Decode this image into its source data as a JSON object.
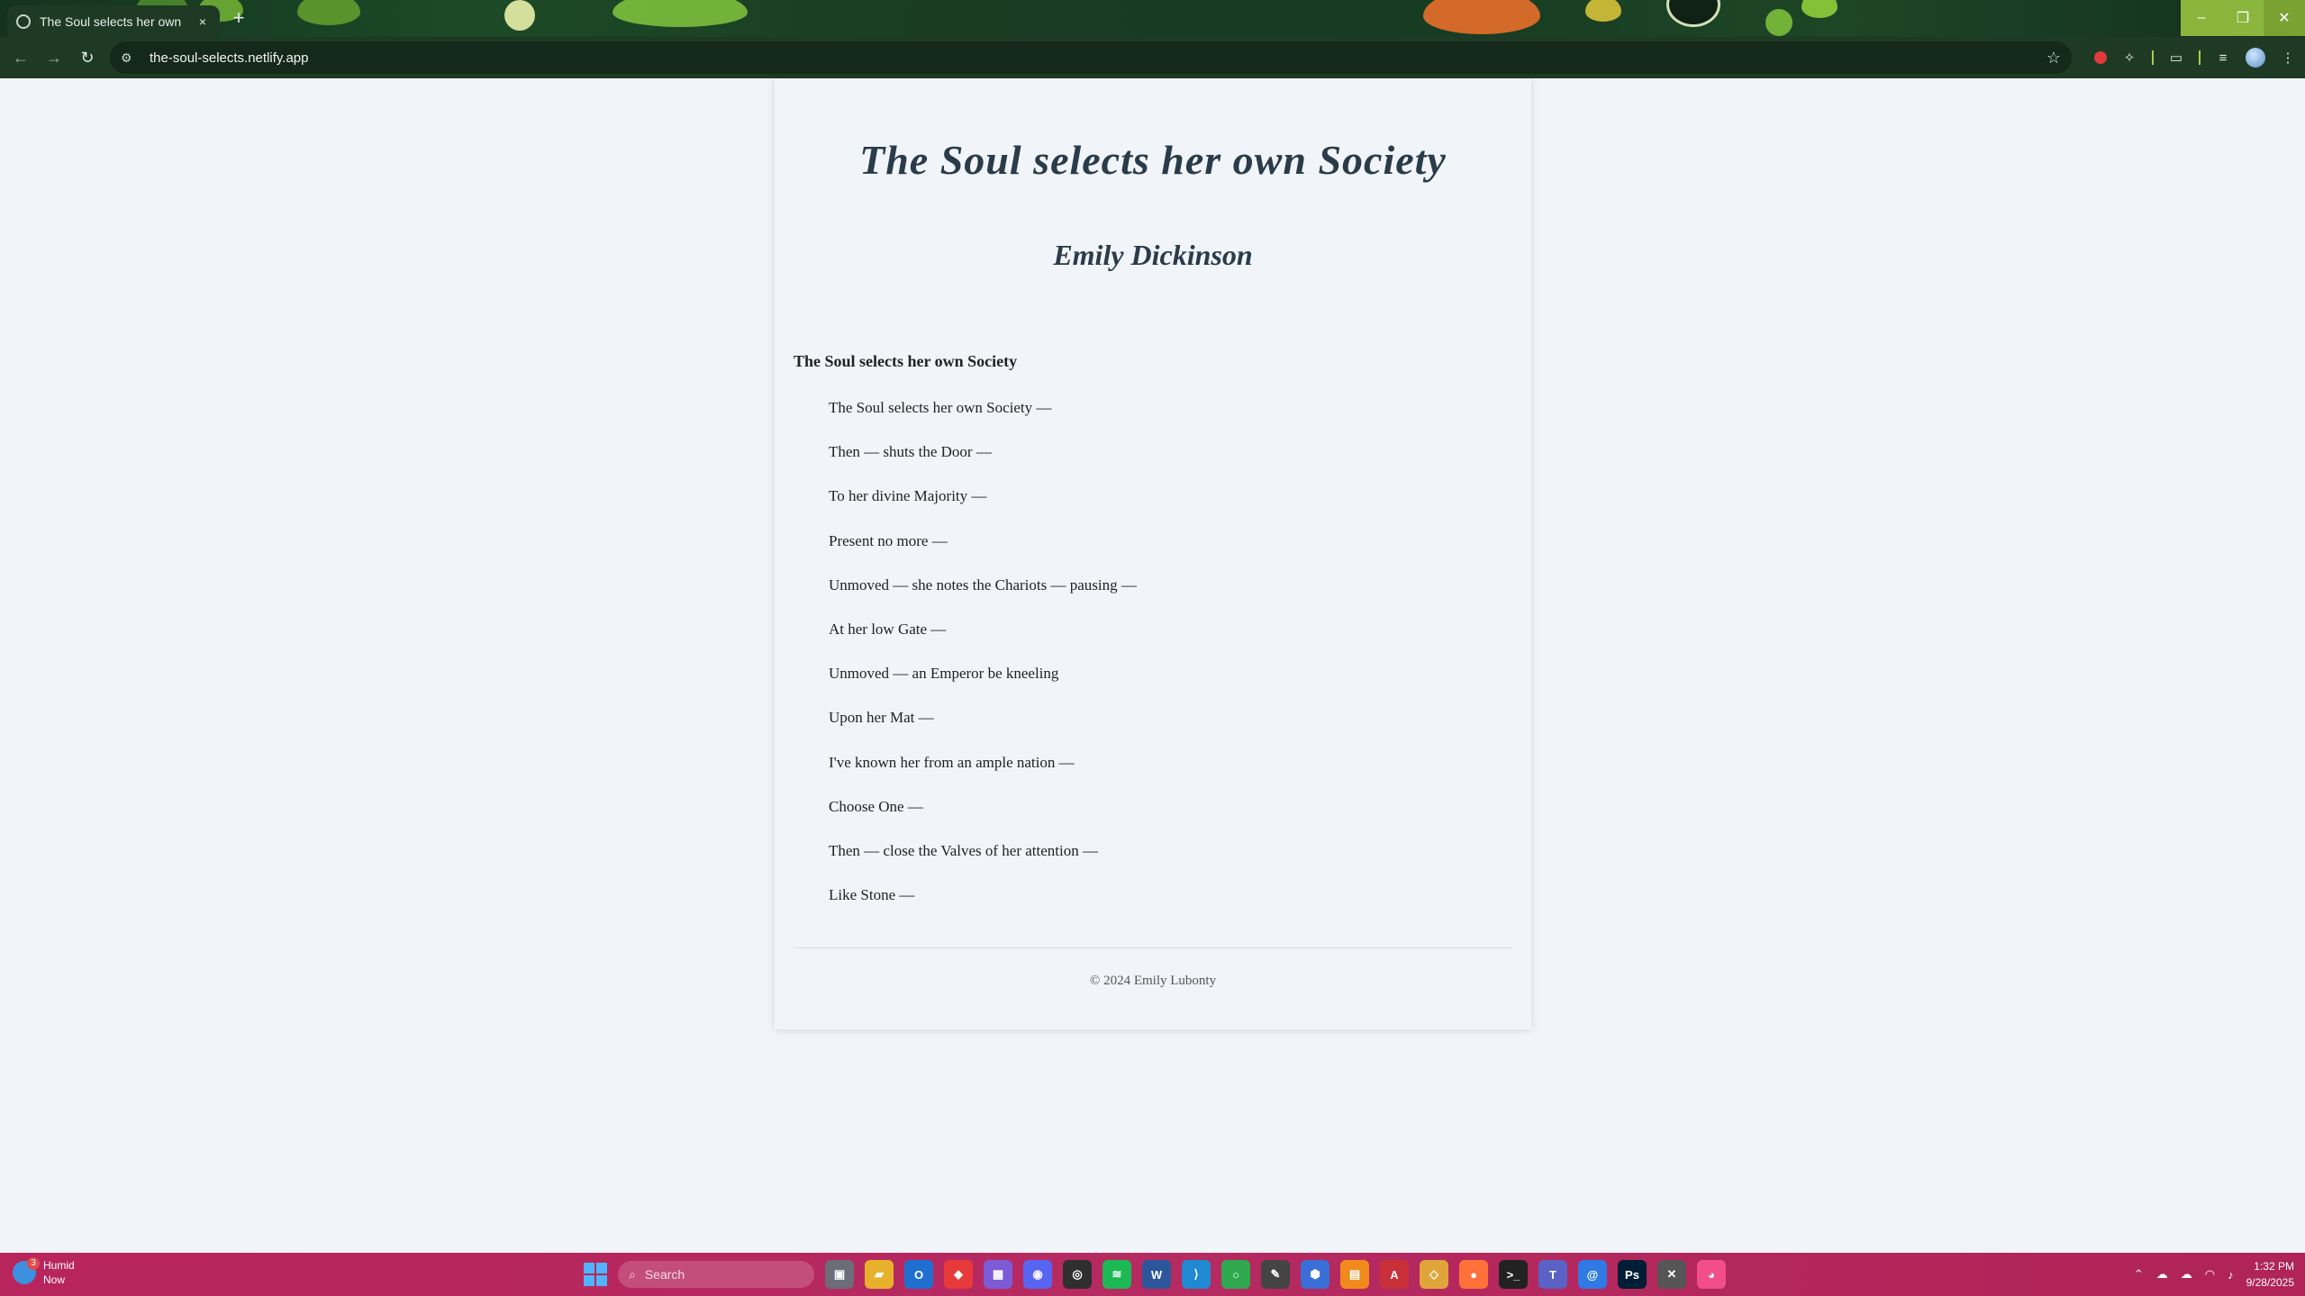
{
  "browser": {
    "tab_title": "The Soul selects her own Societ",
    "new_tab_label": "+",
    "close_tab_label": "×",
    "url": "the-soul-selects.netlify.app",
    "window_controls": {
      "minimize": "–",
      "maximize": "❐",
      "close": "✕"
    }
  },
  "page": {
    "title": "The Soul selects her own Society",
    "author": "Emily Dickinson",
    "section_heading": "The Soul selects her own Society",
    "lines": [
      "The Soul selects her own Society —",
      "Then — shuts the Door —",
      "To her divine Majority —",
      "Present no more —",
      "Unmoved — she notes the Chariots — pausing —",
      "At her low Gate —",
      "Unmoved — an Emperor be kneeling",
      "Upon her Mat —",
      "I've known her from an ample nation —",
      "Choose One —",
      "Then — close the Valves of her attention —",
      "Like Stone —"
    ],
    "footer": "© 2024 Emily Lubonty"
  },
  "taskbar": {
    "weather_title": "Humid",
    "weather_sub": "Now",
    "weather_badge": "3",
    "search_placeholder": "Search",
    "time": "1:32 PM",
    "date": "9/28/2025"
  },
  "colors": {
    "page_bg": "#f1f4f8",
    "title_color": "#2a3b4a",
    "chrome_bg": "#1e3a24",
    "taskbar_bg": "#b52a61"
  }
}
